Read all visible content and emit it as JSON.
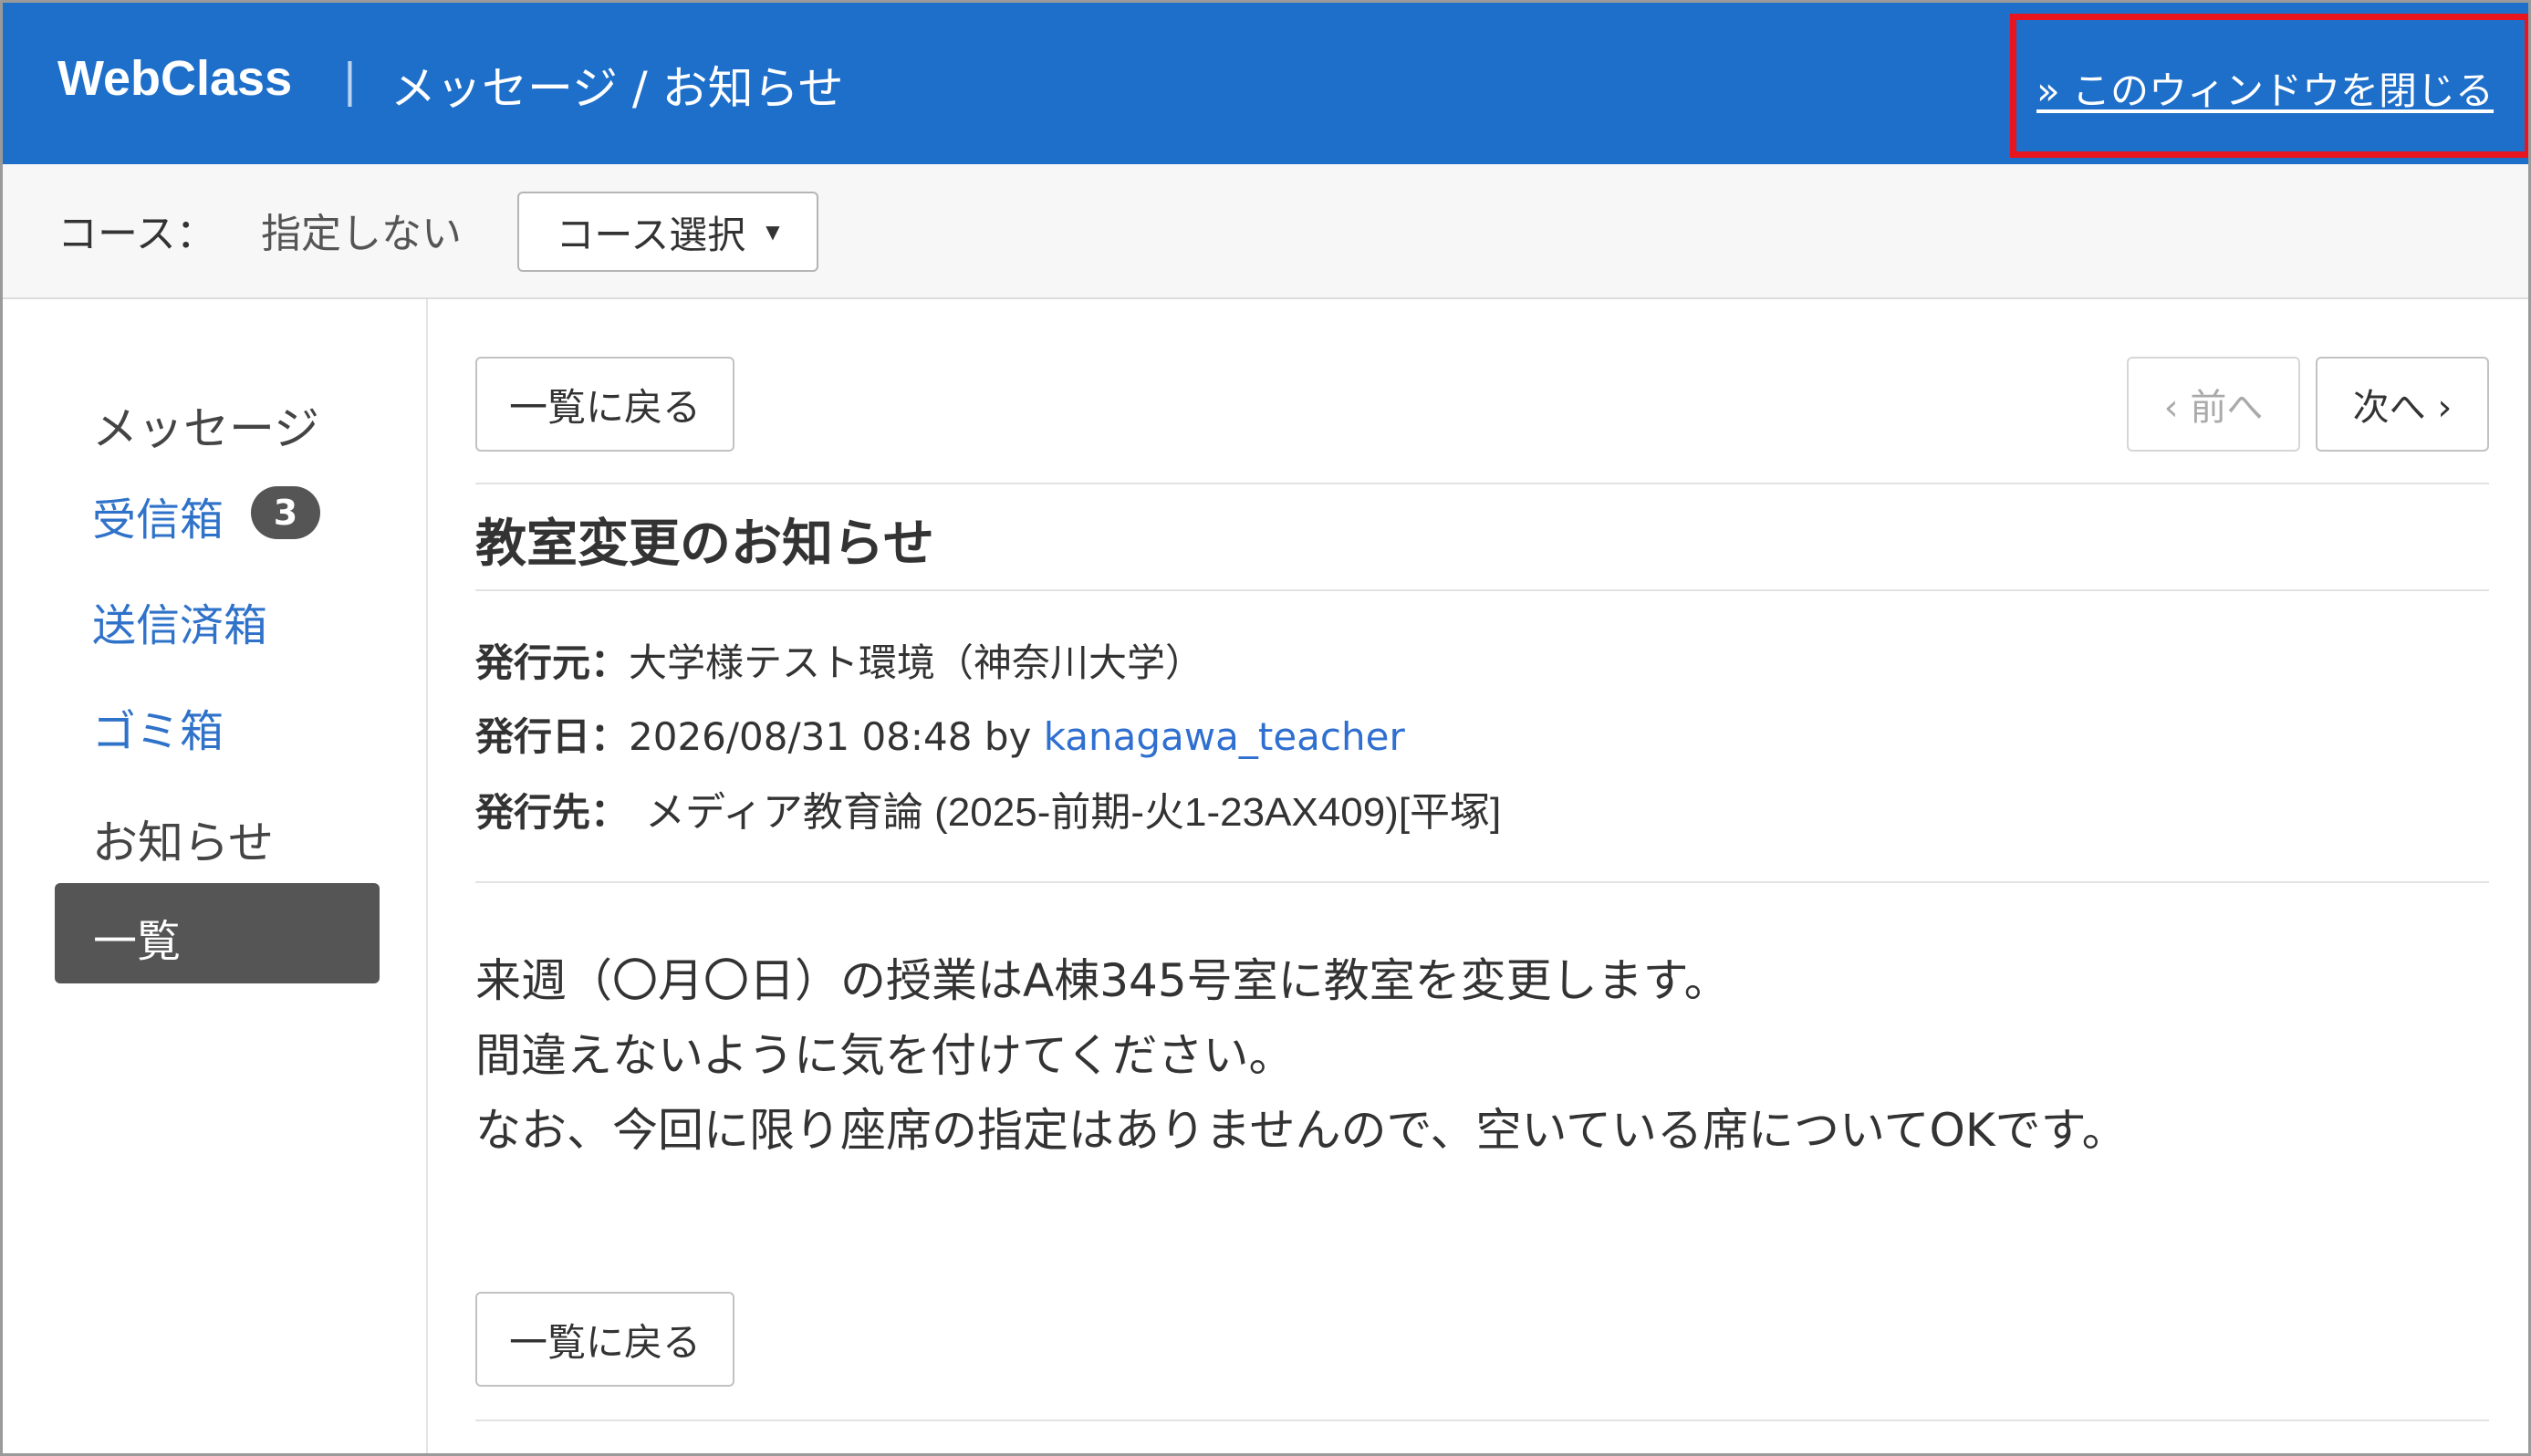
{
  "header": {
    "brand": "WebClass",
    "separator": "|",
    "title": "メッセージ / お知らせ",
    "close_link": "» このウィンドウを閉じる",
    "highlight_color": "#e8141e",
    "background_color": "#1e6fca"
  },
  "course_bar": {
    "label": "コース：",
    "value": "指定しない",
    "select_button": "コース選択",
    "select_caret": "▼"
  },
  "sidebar": {
    "messages_heading": "メッセージ",
    "inbox": "受信箱",
    "inbox_count": "3",
    "sent": "送信済箱",
    "trash": "ゴミ箱",
    "notices_heading": "お知らせ",
    "notices_list": "一覧"
  },
  "toolbar": {
    "back_to_list": "一覧に戻る",
    "prev": "‹ 前へ",
    "next": "次へ ›"
  },
  "message": {
    "title": "教室変更のお知らせ",
    "sender_label": "発行元：",
    "sender": "大学様テスト環境（神奈川大学）",
    "date_label": "発行日：",
    "date": "2026/08/31 08:48 by ",
    "author": "kanagawa_teacher",
    "dest_label": "発行先：",
    "dest": "メディア教育論 (2025-前期-火1-23AX409)[平塚]",
    "body": [
      "来週（〇月〇日）の授業はA棟345号室に教室を変更します。",
      "間違えないように気を付けてください。",
      "なお、今回に限り座席の指定はありませんので、空いている席についてOKです。"
    ]
  },
  "footer": {
    "back_to_list": "一覧に戻る"
  }
}
